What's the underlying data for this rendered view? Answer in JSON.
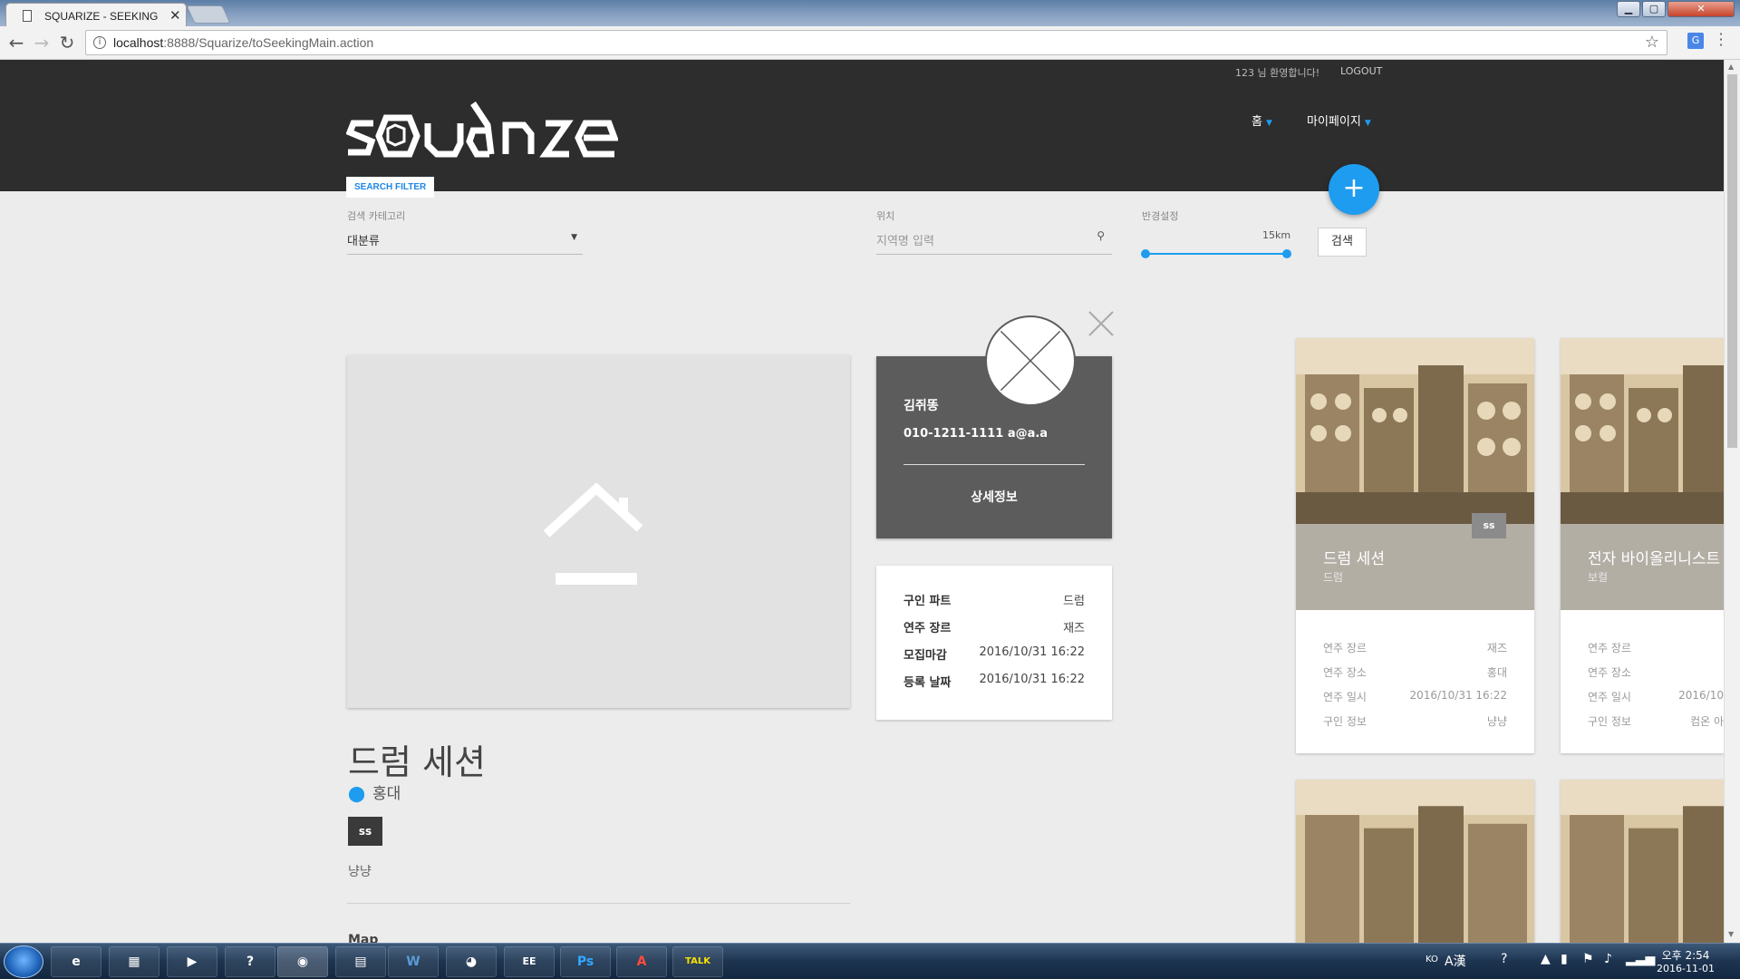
{
  "browser": {
    "tab_title": "SQUARIZE - SEEKING",
    "tab_close": "✕",
    "url_host": "localhost",
    "url_path": ":8888/Squarize/toSeekingMain.action"
  },
  "header": {
    "user_greeting": "123 님 환영합니다!",
    "logout": "LOGOUT",
    "nav": [
      {
        "label": "홈"
      },
      {
        "label": "마이페이지"
      }
    ],
    "filter_tab": "SEARCH FILTER",
    "add_button": "+"
  },
  "filters": {
    "category_label": "검색 카테고리",
    "category_value": "대분류",
    "location_label": "위치",
    "location_placeholder": "지역명 입력",
    "radius_label": "반경설정",
    "radius_value": "15km",
    "radius_fraction": 1.0,
    "search_button": "검색"
  },
  "detail": {
    "title": "드럼 세션",
    "location": "홍대",
    "tag": "ss",
    "description": "냥냥",
    "map_heading": "Map",
    "profile": {
      "name": "김쥐똥",
      "contact": "010-1211-1111 a@a.a",
      "detail_link": "상세정보"
    },
    "info": [
      {
        "key": "구인 파트",
        "value": "드럼"
      },
      {
        "key": "연주 장르",
        "value": "재즈"
      },
      {
        "key": "모집마감",
        "value": "2016/10/31 16:22"
      },
      {
        "key": "등록 날짜",
        "value": "2016/10/31 16:22"
      }
    ]
  },
  "cards": [
    {
      "title": "드럼 세션",
      "subtitle": "드럼",
      "tag": "ss",
      "rows": [
        {
          "key": "연주 장르",
          "value": "재즈"
        },
        {
          "key": "연주 장소",
          "value": "홍대"
        },
        {
          "key": "연주 일시",
          "value": "2016/10/31 16:22"
        },
        {
          "key": "구인 정보",
          "value": "냥냥"
        }
      ]
    },
    {
      "title": "전자 바이올리니스트",
      "subtitle": "보컬",
      "rows": [
        {
          "key": "연주 장르",
          "value": ""
        },
        {
          "key": "연주 장소",
          "value": ""
        },
        {
          "key": "연주 일시",
          "value": "2016/10"
        },
        {
          "key": "구인 정보",
          "value": "컴온 아"
        }
      ]
    }
  ],
  "taskbar": {
    "apps": [
      "e",
      "▦",
      "▶",
      "?",
      "◉",
      "▤",
      "W",
      "◕",
      "EE",
      "Ps",
      "A",
      "TALK"
    ],
    "lang": "KO",
    "time": "오후 2:54",
    "date": "2016-11-01"
  },
  "colors": {
    "accent": "#1e9cef",
    "header_bg": "#2d2d2d",
    "card_band": "#b3aea4"
  }
}
